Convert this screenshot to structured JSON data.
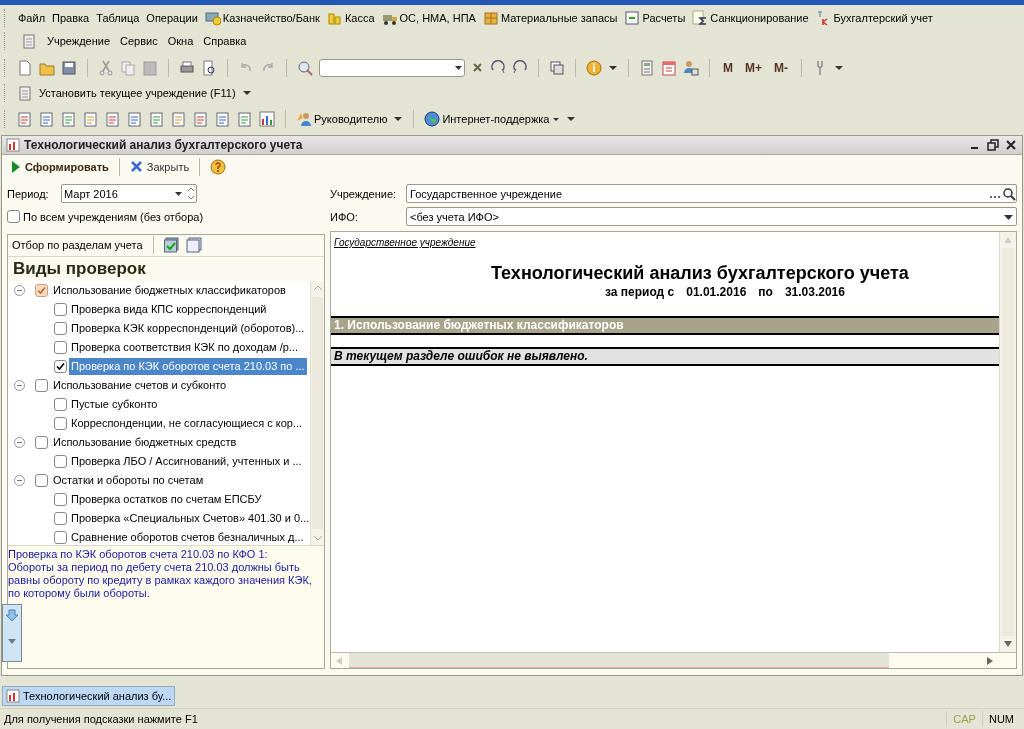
{
  "menu_bar": {
    "items": [
      {
        "label": "Файл"
      },
      {
        "label": "Правка"
      },
      {
        "label": "Таблица"
      },
      {
        "label": "Операции"
      },
      {
        "label": "Казначейство/Банк"
      },
      {
        "label": "Касса"
      },
      {
        "label": "ОС, НМА, НПА"
      },
      {
        "label": "Материальные запасы"
      },
      {
        "label": "Расчеты"
      },
      {
        "label": "Санкционирование"
      },
      {
        "label": "Бухгалтерский учет"
      }
    ]
  },
  "secondary_menu": {
    "items": [
      {
        "label": "Учреждение"
      },
      {
        "label": "Сервис"
      },
      {
        "label": "Окна"
      },
      {
        "label": "Справка"
      }
    ]
  },
  "toolbar": {
    "memory_buttons": [
      "M",
      "M+",
      "M-"
    ]
  },
  "institution_toolbar": {
    "label": "Установить текущее учреждение (F11)"
  },
  "reports_toolbar": {
    "buttons": [
      "Руководителю",
      "Интернет-поддержка"
    ]
  },
  "form": {
    "title": "Технологический анализ бухгалтерского учета",
    "actions": [
      "Сформировать",
      "Закрыть"
    ],
    "period": {
      "label": "Период:",
      "value": "Март 2016"
    },
    "all_institutions": {
      "label": "По всем учреждениям (без отбора)",
      "checked": false
    },
    "filter_label": "Отбор по разделам учета",
    "tree_title": "Виды проверок",
    "tree": [
      {
        "label": "Использование бюджетных классификаторов",
        "checked": true,
        "expanded": true,
        "selected": false,
        "children": [
          {
            "label": "Проверка вида КПС корреспонденций",
            "checked": false,
            "selected": false
          },
          {
            "label": "Проверка КЭК корреспонденций (оборотов)...",
            "checked": false,
            "selected": false
          },
          {
            "label": "Проверка соответствия КЭК по доходам /р...",
            "checked": false,
            "selected": false
          },
          {
            "label": "Проверка по КЭК оборотов счета 210.03 по ...",
            "checked": true,
            "selected": true
          }
        ]
      },
      {
        "label": "Использование счетов и субконто",
        "checked": false,
        "expanded": true,
        "selected": false,
        "children": [
          {
            "label": "Пустые субконто",
            "checked": false,
            "selected": false
          },
          {
            "label": "Корреспонденции, не согласующиеся с кор...",
            "checked": false,
            "selected": false
          }
        ]
      },
      {
        "label": "Использование бюджетных средств",
        "checked": false,
        "expanded": true,
        "selected": false,
        "children": [
          {
            "label": "Проверка ЛБО / Ассигнований, учтенных и ...",
            "checked": false,
            "selected": false
          }
        ]
      },
      {
        "label": "Остатки и обороты по счетам",
        "checked": false,
        "expanded": true,
        "selected": false,
        "children": [
          {
            "label": "Проверка остатков по счетам ЕПСБУ",
            "checked": false,
            "selected": false
          },
          {
            "label": "Проверка «Специальных Счетов» 401.30 и 0...",
            "checked": false,
            "selected": false
          },
          {
            "label": "Сравнение оборотов счетов безналичных д...",
            "checked": false,
            "selected": false
          }
        ]
      }
    ],
    "description": [
      "Проверка по КЭК оборотов счета 210.03 по КФО 1:",
      "Обороты за период по дебету счета 210.03 должны быть равны обороту по кредиту в рамках каждого значения КЭК, по которому были обороты."
    ],
    "institution": {
      "label": "Учреждение:",
      "value": "Государственное учреждение"
    },
    "ifo": {
      "label": "ИФО:",
      "value": "<без учета ИФО>"
    },
    "report": {
      "organization": "Государственное учреждение",
      "title": "Технологический анализ бухгалтерского учета",
      "period_parts": [
        "за период с",
        "01.01.2016",
        "по",
        "31.03.2016"
      ],
      "sections": [
        {
          "heading": "1. Использование бюджетных классификаторов",
          "message": "В текущем разделе ошибок не выявлено."
        }
      ]
    }
  },
  "taskbar": [
    {
      "label": "Технологический анализ бу...",
      "selected": true
    }
  ],
  "status_bar": {
    "hint": "Для получения подсказки нажмите F1",
    "indicators": [
      {
        "label": "CAP",
        "on": false
      },
      {
        "label": "NUM",
        "on": true
      }
    ]
  }
}
